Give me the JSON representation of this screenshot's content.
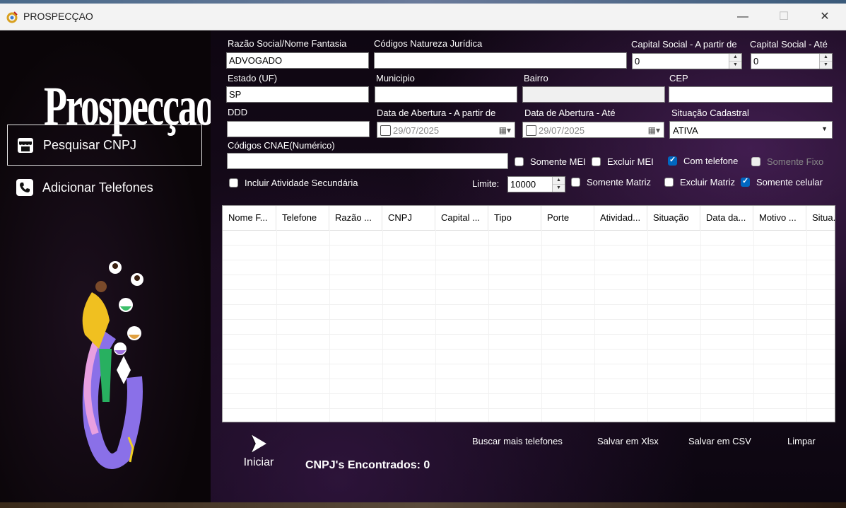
{
  "window": {
    "title": "PROSPECÇAO",
    "minimize": "—",
    "maximize": "☐",
    "close": "✕"
  },
  "sidebar": {
    "logo_text": "Prospecçao",
    "nav": [
      {
        "label": "Pesquisar CNPJ",
        "icon": "store-icon",
        "active": true
      },
      {
        "label": "Adicionar Telefones",
        "icon": "phone-icon",
        "active": false
      }
    ],
    "bottom_icons": [
      "home-icon",
      "info-icon",
      "add-icon",
      "refresh-icon",
      "save-icon"
    ]
  },
  "form": {
    "razao_label": "Razão Social/Nome Fantasia",
    "razao_value": "ADVOGADO",
    "natureza_label": "Códigos Natureza Jurídica",
    "natureza_value": "",
    "capital_de_label": "Capital Social - A partir de",
    "capital_de_value": "0",
    "capital_ate_label": "Capital Social - Até",
    "capital_ate_value": "0",
    "estado_label": "Estado (UF)",
    "estado_value": "SP",
    "municipio_label": "Municipio",
    "municipio_value": "",
    "bairro_label": "Bairro",
    "bairro_value": "",
    "cep_label": "CEP",
    "cep_value": "",
    "ddd_label": "DDD",
    "ddd_value": "",
    "abertura_de_label": "Data de Abertura - A partir de",
    "abertura_de_value": "29/07/2025",
    "abertura_ate_label": "Data de Abertura - Até",
    "abertura_ate_value": "29/07/2025",
    "situacao_label": "Situação Cadastral",
    "situacao_value": "ATIVA",
    "cnae_label": "Códigos CNAE(Numérico)",
    "cnae_value": "",
    "limite_label": "Limite:",
    "limite_value": "10000",
    "checks": {
      "somente_mei": {
        "label": "Somente MEI",
        "checked": false
      },
      "excluir_mei": {
        "label": "Excluir MEI",
        "checked": false
      },
      "com_telefone": {
        "label": "Com telefone",
        "checked": true
      },
      "somente_fixo": {
        "label": "Somente Fixo",
        "checked": false
      },
      "incluir_secundaria": {
        "label": "Incluir Atividade Secundária",
        "checked": false
      },
      "somente_matriz": {
        "label": "Somente Matriz",
        "checked": false
      },
      "excluir_matriz": {
        "label": "Excluir Matriz",
        "checked": false
      },
      "somente_celular": {
        "label": "Somente celular",
        "checked": true
      }
    }
  },
  "grid": {
    "columns": [
      "Nome F...",
      "Telefone",
      "Razão ...",
      "CNPJ",
      "Capital ...",
      "Tipo",
      "Porte",
      "Atividad...",
      "Situação",
      "Data da...",
      "Motivo ...",
      "Situa..."
    ]
  },
  "actions": {
    "iniciar": "Iniciar",
    "buscar_mais": "Buscar mais telefones",
    "salvar_xlsx": "Salvar em Xlsx",
    "salvar_csv": "Salvar em CSV",
    "limpar": "Limpar",
    "encontrados": "CNPJ's Encontrados: 0"
  },
  "colors": {
    "accent": "#0067c0",
    "sidebar_bg": "#0a0508",
    "main_bg": "#170b1c"
  }
}
